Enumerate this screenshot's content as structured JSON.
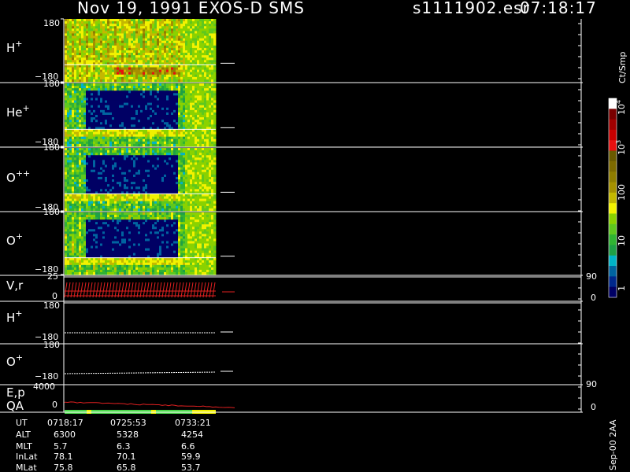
{
  "header": {
    "title": "Nov 19, 1991   EXOS-D SMS",
    "file": "s1111902.esr",
    "time": "07:18:17"
  },
  "footer_meta": "Sep-00 2AA",
  "colorbar": {
    "title": "Ct/Smp",
    "labels": [
      "10^4",
      "10^3",
      "100",
      "10",
      "1"
    ],
    "colors": [
      "#ffffff",
      "#7a0000",
      "#a00000",
      "#c80000",
      "#e81010",
      "#6a5a00",
      "#7d6a00",
      "#8f7d00",
      "#a59000",
      "#c4b800",
      "#f2f200",
      "#8ad200",
      "#5ec81e",
      "#30b432",
      "#1ea046",
      "#00b4c8",
      "#0064a0",
      "#00288c",
      "#000064"
    ]
  },
  "panels": {
    "h_plus": {
      "label": "H+",
      "top": "180",
      "bottom": "−180"
    },
    "he_plus": {
      "label": "He+",
      "top": "180",
      "bottom": "−180"
    },
    "o_pp": {
      "label": "O++",
      "top": "180",
      "bottom": "−180"
    },
    "o_plus": {
      "label": "O+",
      "top": "180",
      "bottom": "−180"
    },
    "vr": {
      "label": "V,r",
      "top": "25",
      "bottom": "0",
      "right_top": "90",
      "right_bottom": "0"
    },
    "h_plus2": {
      "label": "H+",
      "top": "180",
      "bottom": "−180"
    },
    "o_plus2": {
      "label": "O+",
      "top": "180",
      "bottom": "−180"
    },
    "ep": {
      "label": "E,p",
      "top": "4000",
      "bottom": "0",
      "right_top": "90",
      "right_bottom": "0"
    },
    "qa": {
      "label": "QA"
    }
  },
  "chart_data": {
    "type": "heatmap",
    "title": "Nov 19, 1991   EXOS-D SMS",
    "ion_species": [
      "H+",
      "He+",
      "O++",
      "O+"
    ],
    "pitch_angle_range": [
      -180,
      180
    ],
    "colorbar_unit": "Ct/Smp",
    "colorbar_scale": "log",
    "colorbar_range": [
      1,
      10000
    ],
    "time_ticks": [
      "0718:17",
      "0725:53",
      "0733:21"
    ],
    "ephemeris": {
      "UT": [
        "0718:17",
        "0725:53",
        "0733:21"
      ],
      "ALT": [
        6300,
        5328,
        4254
      ],
      "MLT": [
        5.7,
        6.3,
        6.6
      ],
      "InLat": [
        78.1,
        70.1,
        59.9
      ],
      "MLat": [
        75.8,
        65.8,
        53.7
      ]
    }
  },
  "table": {
    "rows": [
      {
        "name": "UT",
        "values": [
          "0718:17",
          "0725:53",
          "0733:21"
        ]
      },
      {
        "name": "ALT",
        "values": [
          "6300",
          "5328",
          "4254"
        ]
      },
      {
        "name": "MLT",
        "values": [
          "5.7",
          "6.3",
          "6.6"
        ]
      },
      {
        "name": "InLat",
        "values": [
          "78.1",
          "70.1",
          "59.9"
        ]
      },
      {
        "name": "MLat",
        "values": [
          "75.8",
          "65.8",
          "53.7"
        ]
      }
    ]
  }
}
